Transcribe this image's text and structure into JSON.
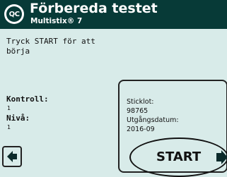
{
  "header": {
    "logo_text": "QC",
    "title": "Förbereda testet",
    "subtitle": "Multistix® 7"
  },
  "main": {
    "instruction_line1": "Tryck START för att",
    "instruction_line2": "börja",
    "control_label": "Kontroll:",
    "control_value": "1",
    "level_label": "Nivå:",
    "level_value": "1"
  },
  "info_box": {
    "lot_label": "Sticklot:",
    "lot_value": "98765",
    "expiry_label": "Utgångsdatum:",
    "expiry_value": "2016-09"
  },
  "buttons": {
    "start_label": "START",
    "back_icon": "left-arrow-icon",
    "start_icon": "right-arrow-icon"
  },
  "colors": {
    "header_bg": "#073a37",
    "screen_bg": "#d8ebe9",
    "text": "#111111"
  }
}
